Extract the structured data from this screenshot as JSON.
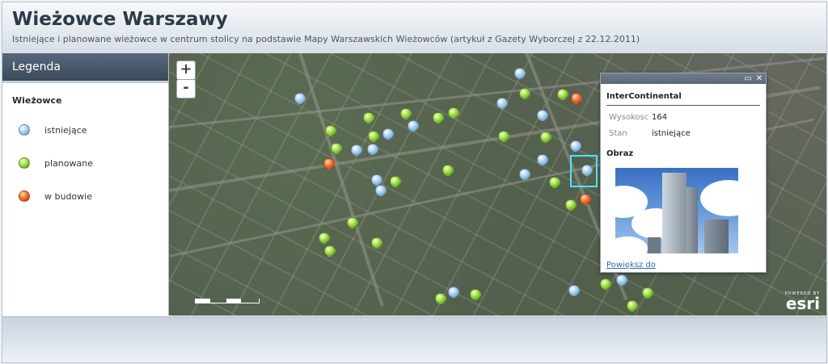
{
  "header": {
    "title": "Wieżowce Warszawy",
    "subtitle": "Istniejące i planowane wieżowce w centrum stolicy na podstawie Mapy Warszawskich Wieżowców (artykuł z Gazety Wyborczej z 22.12.2011)"
  },
  "legend": {
    "title": "Legenda",
    "group": "Wieżowce",
    "items": [
      {
        "label": "istniejące",
        "color": "#5b9bd5"
      },
      {
        "label": "planowane",
        "color": "#7cc82a"
      },
      {
        "label": "w budowie",
        "color": "#e2491a"
      }
    ]
  },
  "map": {
    "zoom_in": "+",
    "zoom_out": "-",
    "attribution": {
      "powered_by": "POWERED BY",
      "logo": "esri"
    }
  },
  "popup": {
    "title": "InterContinental",
    "attributes": [
      {
        "key": "Wysokosc",
        "value": "164"
      },
      {
        "key": "Stan",
        "value": "istniejące"
      }
    ],
    "image_label": "Obraz",
    "zoom_link": "Powiększ do",
    "maximize_icon": "maximize-icon",
    "close_icon": "close-icon"
  }
}
